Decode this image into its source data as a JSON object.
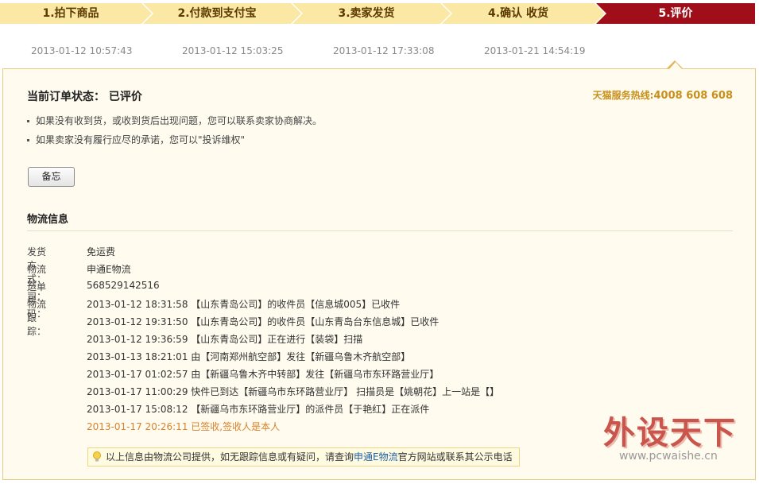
{
  "steps": [
    {
      "label": "1.拍下商品",
      "state": "done"
    },
    {
      "label": "2.付款到支付宝",
      "state": "done"
    },
    {
      "label": "3.卖家发货",
      "state": "done"
    },
    {
      "label": "4.确认 收货",
      "state": "done"
    },
    {
      "label": "5.评价",
      "state": "active"
    }
  ],
  "step_times": [
    "2013-01-12 10:57:43",
    "2013-01-12 15:03:25",
    "2013-01-12 17:33:08",
    "2013-01-21 14:54:19"
  ],
  "status": {
    "title": "当前订单状态： 已评价",
    "hotline_label": "天猫服务热线:",
    "hotline_number": "4008 608 608",
    "bullets": [
      "如果没有收到货，或收到货后出现问题，您可以联系卖家协商解决。",
      "如果卖家没有履行应尽的承诺，您可以\"投诉维权\""
    ],
    "memo_button": "备忘"
  },
  "logistics": {
    "title": "物流信息",
    "ship_method_label": "发货方式：",
    "ship_method": "免运费",
    "company_label": "物流公司：",
    "company": "申通E物流",
    "tracking_no_label": "运单号码：",
    "tracking_no": "568529142516",
    "tracking_label": "物流跟踪：",
    "events": [
      "2013-01-12 18:31:58 【山东青岛公司】的收件员【信息城005】已收件",
      "2013-01-12 19:31:50 【山东青岛公司】的收件员【山东青岛台东信息城】已收件",
      "2013-01-12 19:36:59 【山东青岛公司】正在进行【装袋】扫描",
      "2013-01-13 18:21:01 由【河南郑州航空部】发往【新疆乌鲁木齐航空部】",
      "2013-01-17 01:02:57 由【新疆乌鲁木齐中转部】发往【新疆乌市东环路营业厅】",
      "2013-01-17 11:00:29 快件已到达【新疆乌市东环路营业厅】 扫描员是【姚朝花】上一站是【】",
      "2013-01-17 15:08:12 【新疆乌市东环路营业厅】的派件员【于艳红】正在派件",
      "2013-01-17 20:26:11 已签收,签收人是本人"
    ],
    "tip_prefix": "以上信息由物流公司提供，如无跟踪信息或有疑问，请查询",
    "tip_link": "申通E物流",
    "tip_suffix": "官方网站或联系其公示电话"
  },
  "watermark": {
    "title": "外设天下",
    "url": "www.pcwaishe.cn"
  },
  "colors": {
    "step_done_bg": "#fbe8a5",
    "step_active_bg": "#a00f19",
    "panel_bg": "#fffbef",
    "final_event": "#d9822b",
    "link": "#1f5fa6"
  }
}
